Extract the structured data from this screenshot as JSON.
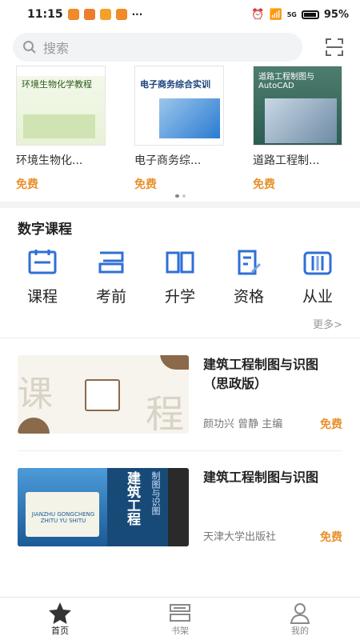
{
  "status_bar": {
    "time": "11:15",
    "network": "5G",
    "battery": "95%"
  },
  "search": {
    "placeholder": "搜索"
  },
  "books": [
    {
      "cover_title": "环境生物化学教程",
      "name": "环境生物化...",
      "price": "免费"
    },
    {
      "cover_title": "电子商务综合实训",
      "name": "电子商务综...",
      "price": "免费"
    },
    {
      "cover_title": "道路工程制图与AutoCAD",
      "name": "道路工程制...",
      "price": "免费"
    }
  ],
  "digital": {
    "title": "数字课程",
    "categories": [
      {
        "label": "课程",
        "icon": "course-icon"
      },
      {
        "label": "考前",
        "icon": "exam-icon"
      },
      {
        "label": "升学",
        "icon": "book-open-icon"
      },
      {
        "label": "资格",
        "icon": "certificate-icon"
      },
      {
        "label": "从业",
        "icon": "career-icon"
      }
    ],
    "more": "更多>"
  },
  "courses": [
    {
      "title": "建筑工程制图与识图（思政版）",
      "author": "颜功兴 曾静 主编",
      "price": "免费",
      "cover_text": [
        "课",
        "程"
      ]
    },
    {
      "title": "建筑工程制图与识图",
      "author": "天津大学出版社",
      "price": "免费",
      "cover_text": [
        "建筑工程",
        "制图与识图",
        "JIANZHU GONGCHENG ZHITU YU SHITU"
      ]
    }
  ],
  "tabs": [
    {
      "label": "首页",
      "icon": "star-icon",
      "active": true
    },
    {
      "label": "书架",
      "icon": "bookshelf-icon",
      "active": false
    },
    {
      "label": "我的",
      "icon": "user-icon",
      "active": false
    }
  ],
  "colors": {
    "accent": "#e8912d",
    "icon_blue": "#2f6fd6"
  }
}
